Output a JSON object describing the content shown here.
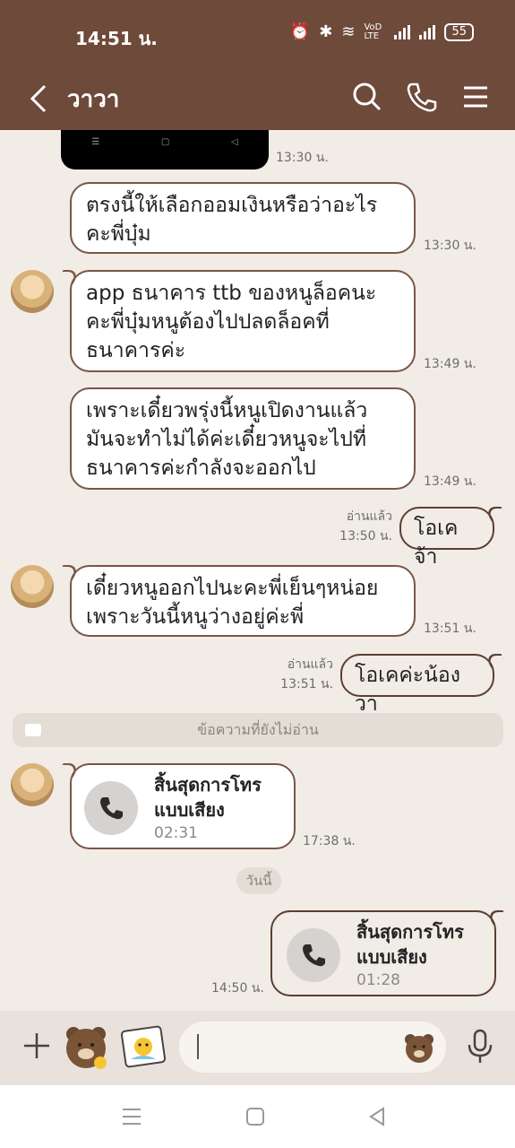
{
  "status_bar": {
    "time": "14:51 น.",
    "battery": "55",
    "net": "VoD LTE"
  },
  "header": {
    "title": "วาวา"
  },
  "thumb_time": "13:30 น.",
  "messages": [
    {
      "text": "ตรงนี้ให้เลือกออมเงินหรือว่าอะไรคะพี่บุ๋ม",
      "time": "13:30 น."
    },
    {
      "text": "app ธนาคาร ttb ของหนูล็อคนะคะพี่บุ๋มหนูต้องไปปลดล็อคที่ธนาคารค่ะ",
      "time": "13:49 น."
    },
    {
      "text": "เพราะเดี๋ยวพรุ่งนี้หนูเปิดงานแล้ว มันจะทำไม่ได้ค่ะเดี๋ยวหนูจะไปที่ธนาคารค่ะกำลังจะออกไป",
      "time": "13:49 น."
    },
    {
      "text": "โอเคจ้า",
      "read": "อ่านแล้ว",
      "time": "13:50 น."
    },
    {
      "text": "เดี๋ยวหนูออกไปนะคะพี่เย็นๆหน่อย เพราะวันนี้หนูว่างอยู่ค่ะพี่",
      "time": "13:51 น."
    },
    {
      "text": "โอเคค่ะน้องวา",
      "read": "อ่านแล้ว",
      "time": "13:51 น."
    }
  ],
  "unread_label": "ข้อความที่ยังไม่อ่าน",
  "calls": [
    {
      "title": "สิ้นสุดการโทร แบบเสียง",
      "duration": "02:31",
      "time": "17:38 น."
    },
    {
      "title": "สิ้นสุดการโทร แบบเสียง",
      "duration": "01:28",
      "time": "14:50 น."
    }
  ],
  "day_divider": "วันนี้",
  "colors": {
    "header": "#6e4a3b",
    "chat_bg": "#f1ece6",
    "bubble_border": "#7a5646"
  }
}
